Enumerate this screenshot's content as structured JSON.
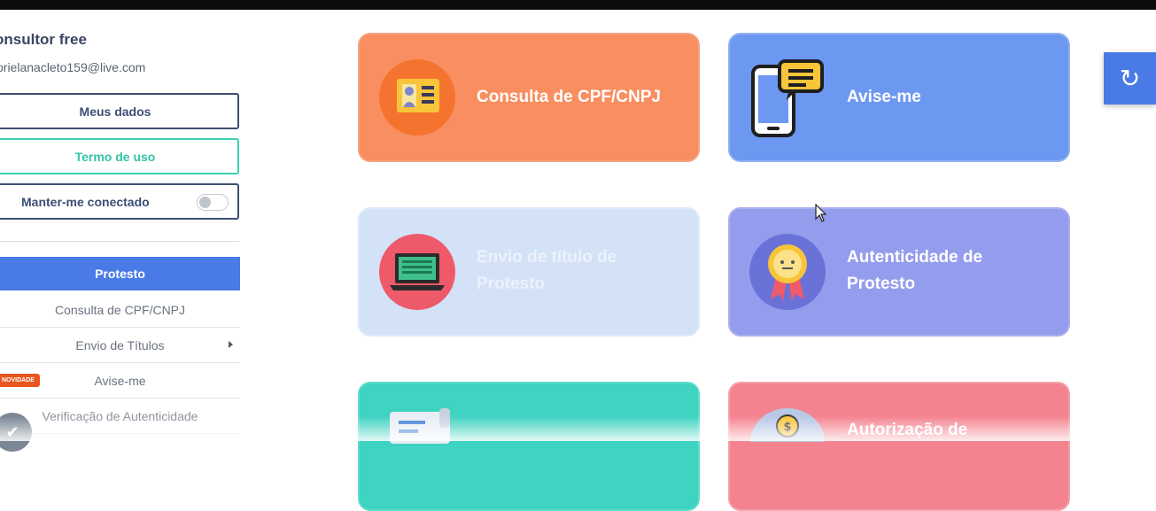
{
  "user": {
    "name": "onsultor free",
    "email": "orielanacleto159@live.com"
  },
  "sidebar": {
    "meus_dados": "Meus dados",
    "termo_de_uso": "Termo de uso",
    "manter_conectado": "Manter-me conectado",
    "manter_conectado_on": false,
    "menu_title": "Protesto",
    "items": [
      {
        "label": "Consulta de CPF/CNPJ"
      },
      {
        "label": "Envio de Títulos"
      },
      {
        "label": "Avise-me",
        "badge": "NOVIDADE"
      },
      {
        "label": "Verificação de Autenticidade"
      }
    ]
  },
  "cards": [
    {
      "title": "Consulta de CPF/CNPJ",
      "color": "#f98e60",
      "icon": "id-card-icon"
    },
    {
      "title": "Avise-me",
      "color": "#6d98f1",
      "icon": "phone-message-icon"
    },
    {
      "title": "Envio de título de Protesto",
      "color": "#d3e2f7",
      "icon": "laptop-icon"
    },
    {
      "title": "Autenticidade de Protesto",
      "color": "#949ced",
      "icon": "award-ribbon-icon"
    },
    {
      "title": "",
      "color": "#3fd3c1",
      "icon": "document-scroll-icon"
    },
    {
      "title": "Autorização de",
      "color": "#f4838f",
      "icon": "coin-icon"
    }
  ],
  "refresh_icon": "refresh-icon",
  "colors": {
    "primary": "#4a7ae6",
    "accent_teal": "#3ccfb4",
    "text_dark": "#3c4e74"
  }
}
